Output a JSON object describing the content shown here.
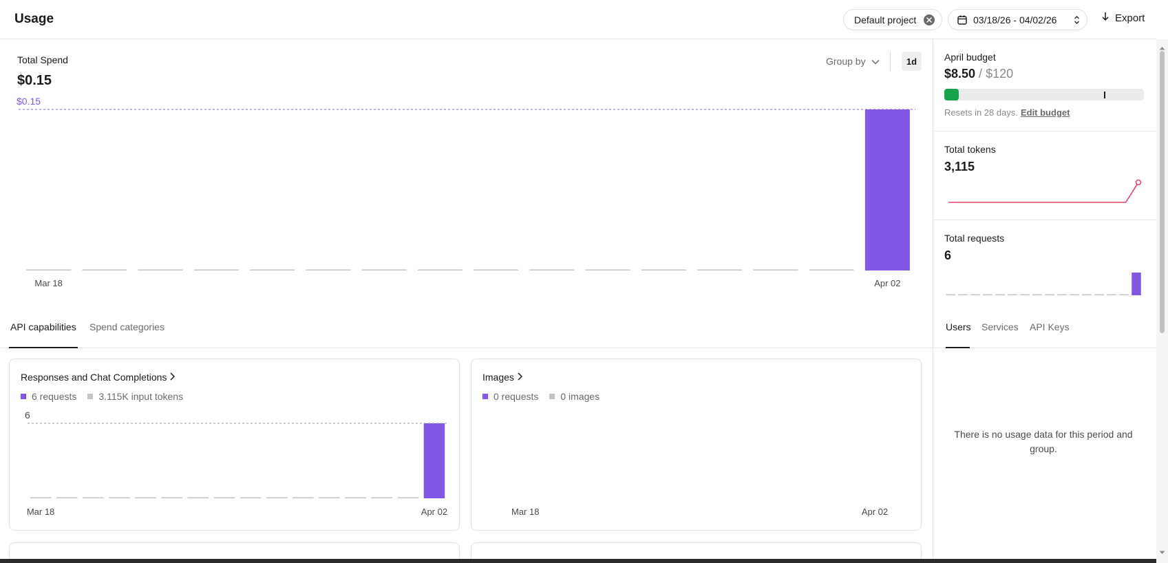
{
  "header": {
    "title": "Usage",
    "project_label": "Default project",
    "date_range": "03/18/26 - 04/02/26",
    "export_label": "Export"
  },
  "spend": {
    "label": "Total Spend",
    "value": "$0.15",
    "group_by_label": "Group by",
    "interval_label": "1d"
  },
  "tabs_left": [
    {
      "label": "API capabilities",
      "active": true
    },
    {
      "label": "Spend categories",
      "active": false
    }
  ],
  "cards": [
    {
      "title": "Responses and Chat Completions",
      "legend": [
        {
          "label": "6 requests",
          "color": "#8257e5"
        },
        {
          "label": "3.115K input tokens",
          "color": "#c4c4c4"
        }
      ]
    },
    {
      "title": "Images",
      "legend": [
        {
          "label": "0 requests",
          "color": "#8257e5"
        },
        {
          "label": "0 images",
          "color": "#c4c4c4"
        }
      ]
    }
  ],
  "sidebar": {
    "budget": {
      "label": "April budget",
      "spent": "$8.50",
      "separator": " / ",
      "limit": "$120",
      "spent_fraction": 0.0708,
      "alert_fraction": 0.8,
      "resets_text": "Resets in 28 days.",
      "edit_label": "Edit budget"
    },
    "tokens": {
      "label": "Total tokens",
      "value": "3,115"
    },
    "requests": {
      "label": "Total requests",
      "value": "6"
    },
    "tabs": [
      {
        "label": "Users",
        "active": true
      },
      {
        "label": "Services",
        "active": false
      },
      {
        "label": "API Keys",
        "active": false
      }
    ],
    "empty_message": "There is no usage data for this period and group."
  },
  "colors": {
    "accent": "#8257e5",
    "budget_fill": "#16a34a",
    "tokens_line": "#e0456b",
    "baseline": "#c4c4c4"
  },
  "chart_data": [
    {
      "name_key": "total_spend",
      "type": "bar",
      "categories": [
        "Mar 18",
        "Mar 19",
        "Mar 20",
        "Mar 21",
        "Mar 22",
        "Mar 23",
        "Mar 24",
        "Mar 25",
        "Mar 26",
        "Mar 27",
        "Mar 28",
        "Mar 29",
        "Mar 30",
        "Mar 31",
        "Apr 01",
        "Apr 02"
      ],
      "values": [
        0,
        0,
        0,
        0,
        0,
        0,
        0,
        0,
        0,
        0,
        0,
        0,
        0,
        0,
        0,
        0.15
      ],
      "tick_labels": [
        "Mar 18",
        "Apr 02"
      ],
      "max_label": "$0.15",
      "ylim": [
        0,
        0.15
      ]
    },
    {
      "name_key": "responses_requests",
      "type": "bar",
      "categories": [
        "Mar 18",
        "Mar 19",
        "Mar 20",
        "Mar 21",
        "Mar 22",
        "Mar 23",
        "Mar 24",
        "Mar 25",
        "Mar 26",
        "Mar 27",
        "Mar 28",
        "Mar 29",
        "Mar 30",
        "Mar 31",
        "Apr 01",
        "Apr 02"
      ],
      "values": [
        0,
        0,
        0,
        0,
        0,
        0,
        0,
        0,
        0,
        0,
        0,
        0,
        0,
        0,
        0,
        6
      ],
      "tick_labels": [
        "Mar 18",
        "Apr 02"
      ],
      "max_label": "6",
      "ylim": [
        0,
        6
      ]
    },
    {
      "name_key": "images_requests",
      "type": "bar",
      "categories": [
        "Mar 18",
        "Mar 19",
        "Mar 20",
        "Mar 21",
        "Mar 22",
        "Mar 23",
        "Mar 24",
        "Mar 25",
        "Mar 26",
        "Mar 27",
        "Mar 28",
        "Mar 29",
        "Mar 30",
        "Mar 31",
        "Apr 01",
        "Apr 02"
      ],
      "values": [
        0,
        0,
        0,
        0,
        0,
        0,
        0,
        0,
        0,
        0,
        0,
        0,
        0,
        0,
        0,
        0
      ],
      "tick_labels": [
        "Mar 18",
        "Apr 02"
      ]
    },
    {
      "name_key": "total_tokens_spark",
      "type": "line",
      "x": [
        "Mar 18",
        "Mar 19",
        "Mar 20",
        "Mar 21",
        "Mar 22",
        "Mar 23",
        "Mar 24",
        "Mar 25",
        "Mar 26",
        "Mar 27",
        "Mar 28",
        "Mar 29",
        "Mar 30",
        "Mar 31",
        "Apr 01",
        "Apr 02"
      ],
      "values": [
        0,
        0,
        0,
        0,
        0,
        0,
        0,
        0,
        0,
        0,
        0,
        0,
        0,
        0,
        0,
        3115
      ]
    },
    {
      "name_key": "total_requests_spark",
      "type": "bar",
      "categories": [
        "Mar 18",
        "Mar 19",
        "Mar 20",
        "Mar 21",
        "Mar 22",
        "Mar 23",
        "Mar 24",
        "Mar 25",
        "Mar 26",
        "Mar 27",
        "Mar 28",
        "Mar 29",
        "Mar 30",
        "Mar 31",
        "Apr 01",
        "Apr 02"
      ],
      "values": [
        0,
        0,
        0,
        0,
        0,
        0,
        0,
        0,
        0,
        0,
        0,
        0,
        0,
        0,
        0,
        6
      ]
    }
  ]
}
